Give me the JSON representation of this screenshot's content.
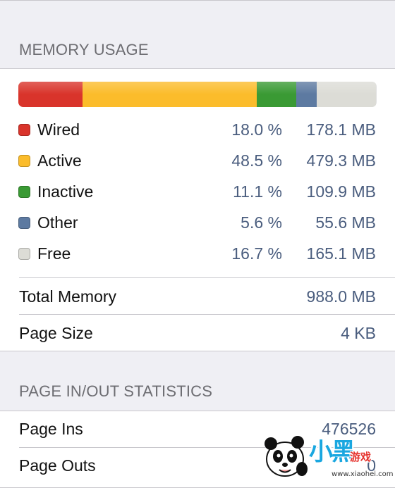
{
  "memory": {
    "header": "MEMORY USAGE",
    "categories": [
      {
        "key": "wired",
        "label": "Wired",
        "percent": "18.0 %",
        "size": "178.1 MB",
        "color": "#d9342b",
        "fraction": 0.18
      },
      {
        "key": "active",
        "label": "Active",
        "percent": "48.5 %",
        "size": "479.3 MB",
        "color": "#fbbc2b",
        "fraction": 0.485
      },
      {
        "key": "inactive",
        "label": "Inactive",
        "percent": "11.1 %",
        "size": "109.9 MB",
        "color": "#3a9a34",
        "fraction": 0.111
      },
      {
        "key": "other",
        "label": "Other",
        "percent": "5.6 %",
        "size": "55.6 MB",
        "color": "#5d7aa1",
        "fraction": 0.056
      },
      {
        "key": "free",
        "label": "Free",
        "percent": "16.7 %",
        "size": "165.1 MB",
        "color": "#dcdcd6",
        "fraction": 0.167
      }
    ],
    "total_label": "Total Memory",
    "total_value": "988.0 MB",
    "page_size_label": "Page Size",
    "page_size_value": "4 KB"
  },
  "page_stats": {
    "header": "PAGE IN/OUT STATISTICS",
    "page_ins_label": "Page Ins",
    "page_ins_value": "476526",
    "page_outs_label": "Page Outs",
    "page_outs_value": "0"
  },
  "watermark": {
    "logo_text": "小黑",
    "logo_sub": "游戏",
    "url": "www.xiaohei.com",
    "icon": "panda-mascot-icon"
  }
}
